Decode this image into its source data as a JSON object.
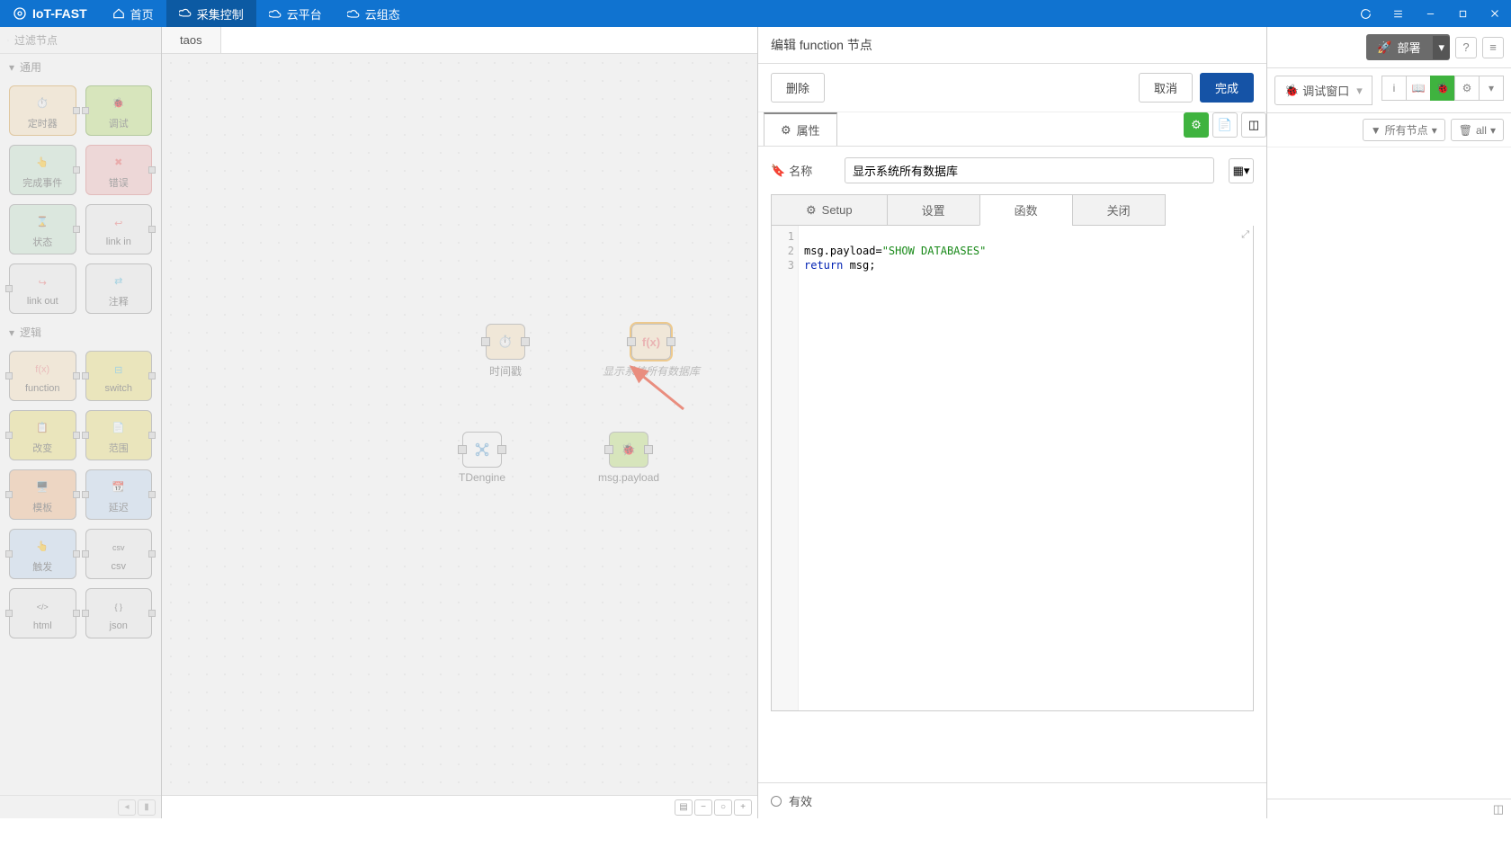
{
  "app": {
    "title": "IoT-FAST"
  },
  "nav": {
    "home": "首页",
    "collect": "采集控制",
    "cloud": "云平台",
    "config": "云组态"
  },
  "palette": {
    "filter_placeholder": "过滤节点",
    "cat_common": "通用",
    "cat_logic": "逻辑",
    "nodes": {
      "timer": "定时器",
      "debug": "调试",
      "complete": "完成事件",
      "error": "错误",
      "status": "状态",
      "linkin": "link in",
      "linkout": "link out",
      "comment": "注释",
      "function": "function",
      "switch": "switch",
      "change": "改变",
      "range": "范围",
      "template": "模板",
      "delay": "延迟",
      "trigger": "触发",
      "csv": "csv",
      "html": "html",
      "json": "json"
    }
  },
  "canvas": {
    "tab": "taos",
    "nodes": {
      "n1": "时间戳",
      "n2": "显示系统所有数据库",
      "n3": "TDengine",
      "n4": "msg.payload"
    }
  },
  "edit": {
    "title": "编辑 function 节点",
    "delete": "删除",
    "cancel": "取消",
    "done": "完成",
    "props": "属性",
    "name_label": "名称",
    "name_value": "显示系统所有数据库",
    "tab_setup": "Setup",
    "tab_settings": "设置",
    "tab_func": "函数",
    "tab_close": "关闭",
    "code_line1": "",
    "code_line2_a": "msg.payload=",
    "code_line2_b": "\"SHOW DATABASES\"",
    "code_line3_a": "return",
    "code_line3_b": " msg;",
    "valid": "有效"
  },
  "right": {
    "deploy": "部署",
    "debug_tab": "调试窗口",
    "all_nodes": "所有节点",
    "all": "all"
  }
}
